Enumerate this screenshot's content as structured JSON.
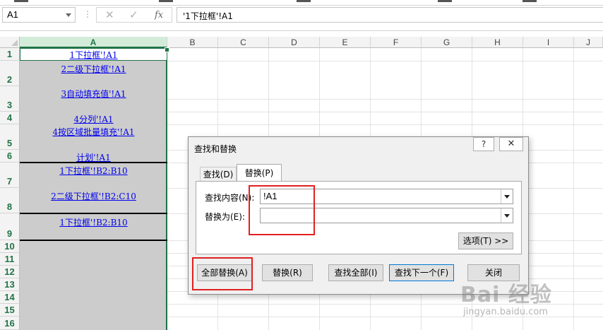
{
  "formula_bar": {
    "name_box": "A1",
    "cancel_glyph": "✕",
    "enter_glyph": "✓",
    "fx_label": "fx",
    "formula": "'1下拉框'!A1"
  },
  "sheet": {
    "columns": [
      "A",
      "B",
      "C",
      "D",
      "E",
      "F",
      "G",
      "H",
      "I",
      "J"
    ],
    "rows": [
      "1",
      "2",
      "3",
      "4",
      "5",
      "6",
      "7",
      "8",
      "9",
      "10",
      "11",
      "12",
      "13",
      "14",
      "15",
      "16"
    ],
    "links": [
      "1下拉框'!A1",
      "2二级下拉框'!A1",
      "3自动填充值'!A1",
      "4分列'!A1",
      "4按区域批量填充'!A1",
      "计划'!A1",
      "1下拉框'!B2:B10",
      "2二级下拉框'!B2:C10",
      "1下拉框'!B2:B10"
    ]
  },
  "dialog": {
    "title": "查找和替换",
    "help": "?",
    "close": "✕",
    "tabs": {
      "find": "查找(D)",
      "replace": "替换(P)"
    },
    "find_label": "查找内容(N):",
    "find_value": "!A1",
    "replace_label": "替换为(E):",
    "replace_value": "",
    "options_button": "选项(T) >>",
    "buttons": {
      "replace_all": "全部替换(A)",
      "replace": "替换(R)",
      "find_all": "查找全部(I)",
      "find_next": "查找下一个(F)",
      "close": "关闭"
    }
  },
  "watermark": {
    "logo": "Bai 经验",
    "url": "jingyan.baidu.com"
  },
  "colors": {
    "excel_green": "#217346",
    "highlight_red": "#e02020",
    "link_blue": "#0000ee",
    "column_fill": "#cccccc"
  }
}
